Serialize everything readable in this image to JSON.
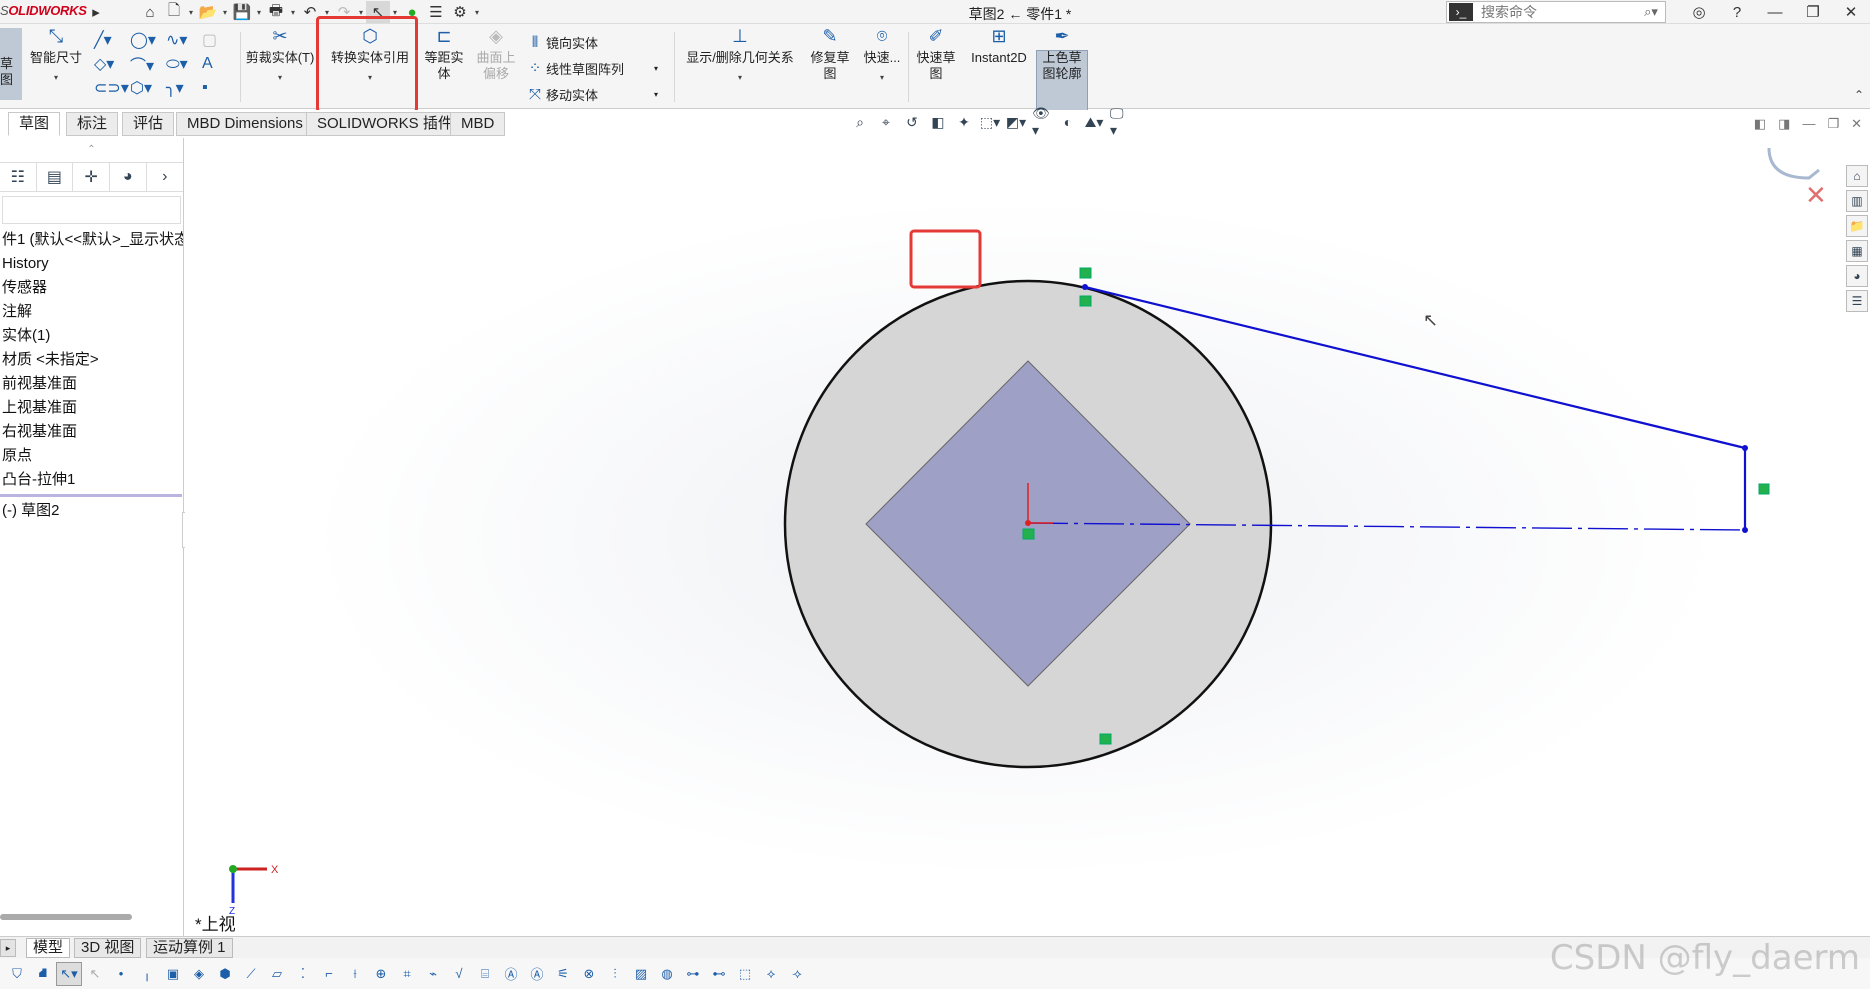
{
  "app": {
    "logo_prefix": "S",
    "logo_main": "OLID",
    "logo_suffix": "WORKS",
    "window_title": "草图2 ← 零件1 *"
  },
  "search": {
    "placeholder": "搜索命令"
  },
  "ribbon": {
    "sketch_tab_label": "草图",
    "smart_dim": "智能尺寸",
    "trim": "剪裁实体(T)",
    "convert": "转换实体引用",
    "offset": "等距实体",
    "surface_offset": "曲面上偏移",
    "mirror": "镜向实体",
    "linear_pattern": "线性草图阵列",
    "move": "移动实体",
    "relations": "显示/删除几何关系",
    "repair": "修复草图",
    "quick_snap": "快速...",
    "quick_sketch": "快速草图",
    "instant2d": "Instant2D",
    "shaded_contour": "上色草图轮廓"
  },
  "tabs": [
    {
      "label": "草图"
    },
    {
      "label": "标注"
    },
    {
      "label": "评估"
    },
    {
      "label": "MBD Dimensions"
    },
    {
      "label": "SOLIDWORKS 插件"
    },
    {
      "label": "MBD"
    }
  ],
  "tree": {
    "root": "件1  (默认<<默认>_显示状态",
    "items": [
      "History",
      "传感器",
      "注解",
      "实体(1)",
      "材质 <未指定>",
      "前视基准面",
      "上视基准面",
      "右视基准面",
      "原点",
      "凸台-拉伸1"
    ],
    "active_sketch": "(-) 草图2"
  },
  "viewport": {
    "view_label": "*上视",
    "axis_x": "X",
    "axis_z": "Z",
    "circle_color": "#d6d6d6",
    "square_color": "#9ea0c6",
    "sketch_color": "#1010d0"
  },
  "bottom_tabs": [
    {
      "label": "模型"
    },
    {
      "label": "3D 视图"
    },
    {
      "label": "运动算例 1"
    }
  ],
  "watermark": "CSDN @fly_daerm"
}
